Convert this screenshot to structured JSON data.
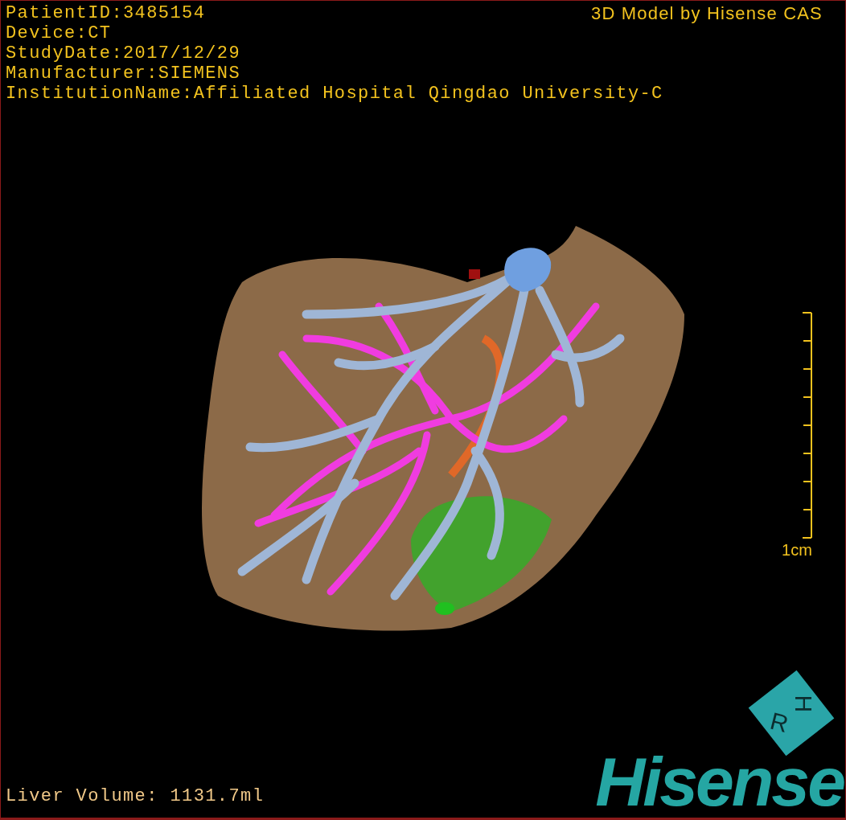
{
  "info_lines": [
    "PatientID:3485154",
    "Device:CT",
    "StudyDate:2017/12/29",
    "Manufacturer:SIEMENS",
    "InstitutionName:Affiliated Hospital Qingdao University-C"
  ],
  "title": "3D Model by Hisense CAS",
  "scale_bar": {
    "label": "1cm"
  },
  "liver_volume": "Liver Volume: 1131.7ml",
  "orientation_cube": {
    "labels": [
      "R",
      "H"
    ]
  },
  "logo": "Hisense"
}
